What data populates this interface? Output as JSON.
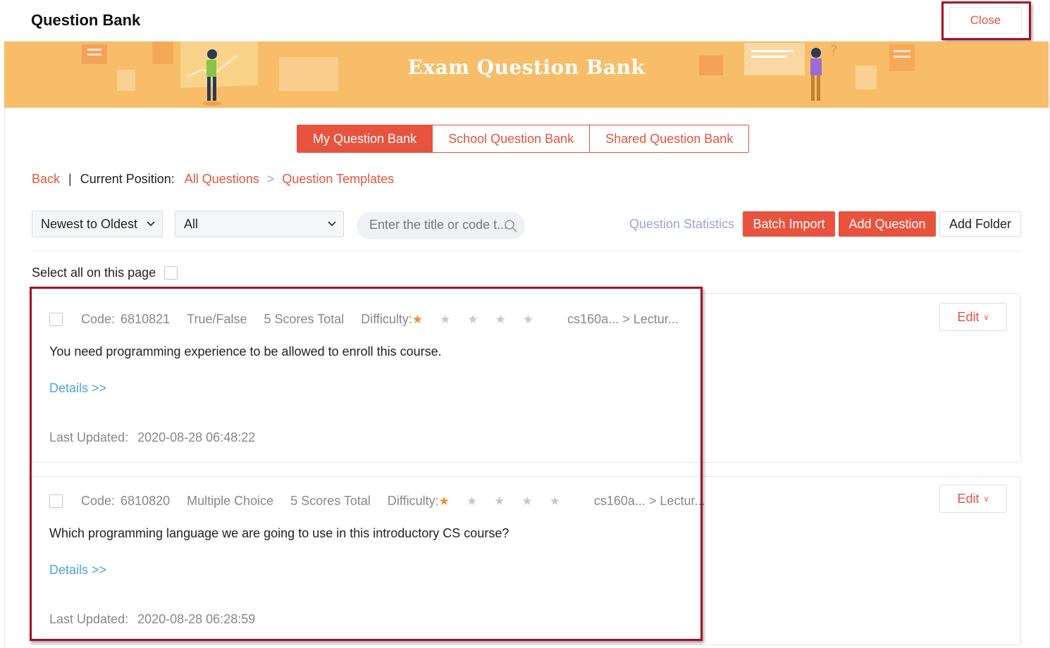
{
  "header": {
    "title": "Question Bank",
    "close_label": "Close"
  },
  "banner": {
    "title": "Exam Question Bank"
  },
  "tabs": [
    {
      "label": "My Question Bank",
      "active": true
    },
    {
      "label": "School Question Bank",
      "active": false
    },
    {
      "label": "Shared Question Bank",
      "active": false
    }
  ],
  "breadcrumb": {
    "back": "Back",
    "sep": "|",
    "current_label": "Current Position:",
    "items": [
      "All Questions",
      "Question Templates"
    ],
    "arrow": ">"
  },
  "toolbar": {
    "sort_value": "Newest to Oldest",
    "filter_value": "All",
    "search_placeholder": "Enter the title or code t...",
    "stats_label": "Question Statistics",
    "batch_import_label": "Batch Import",
    "add_question_label": "Add Question",
    "add_folder_label": "Add Folder"
  },
  "select_all_label": "Select all on this page",
  "questions": [
    {
      "code_label": "Code:",
      "code": "6810821",
      "type": "True/False",
      "scores": "5 Scores Total",
      "difficulty_label": "Difficulty:",
      "difficulty": 1,
      "difficulty_max": 5,
      "path": "cs160a... > Lectur...",
      "text": "You need programming experience to be allowed to enroll this course.",
      "details_label": "Details >>",
      "updated_label": "Last Updated:",
      "updated": "2020-08-28 06:48:22",
      "edit_label": "Edit"
    },
    {
      "code_label": "Code:",
      "code": "6810820",
      "type": "Multiple Choice",
      "scores": "5 Scores Total",
      "difficulty_label": "Difficulty:",
      "difficulty": 1,
      "difficulty_max": 5,
      "path": "cs160a... > Lectur...",
      "text": "Which programming language we are going to use in this introductory CS course?",
      "details_label": "Details >>",
      "updated_label": "Last Updated:",
      "updated": "2020-08-28 06:28:59",
      "edit_label": "Edit"
    }
  ],
  "colors": {
    "accent": "#e8533f",
    "banner": "#f7bd68",
    "link": "#4aa3df",
    "stats": "#9aa4d6",
    "highlight": "#a80f1f",
    "star_on": "#f08d2e"
  }
}
